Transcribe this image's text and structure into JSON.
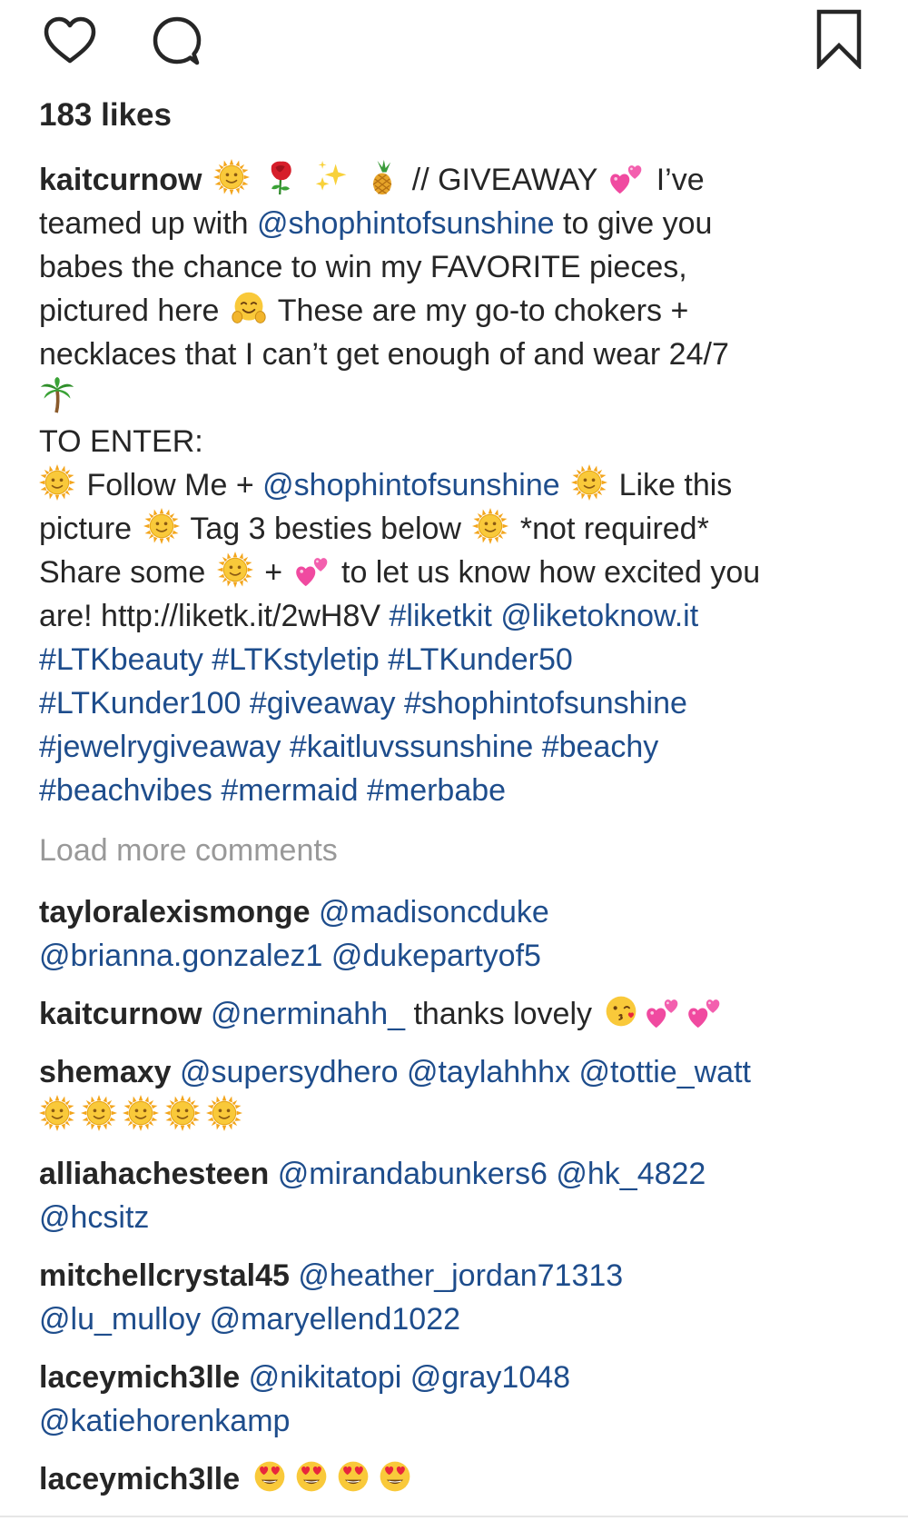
{
  "actions": {
    "like_icon": "heart-outline-icon",
    "comment_icon": "speech-bubble-icon",
    "save_icon": "bookmark-outline-icon"
  },
  "likes_text": "183 likes",
  "caption": {
    "username": "kaitcurnow",
    "l1_text_a": "// GIVEAWAY",
    "l1_text_b": "I’ve",
    "l2_text_a": "teamed up with",
    "l2_mention": "@shophintofsunshine",
    "l2_text_b": "to give you",
    "l3": "babes the chance to win my FAVORITE pieces,",
    "l4_text_a": "pictured here",
    "l4_text_b": "These are my go-to chokers +",
    "l5": "necklaces that I can’t get enough of and wear 24/7",
    "l7": "TO ENTER:",
    "l8_text_a": "Follow Me +",
    "l8_mention": "@shophintofsunshine",
    "l8_text_b": "Like this",
    "l9_text_a": "picture",
    "l9_text_b": "Tag 3 besties below",
    "l9_text_c": "*not required*",
    "l10_text_a": "Share some",
    "l10_text_b": "+",
    "l10_text_c": "to let us know how excited you",
    "l11_text_a": "are! http://liketk.it/2wH8V",
    "l11_tag_a": "#liketkit",
    "l11_mention": "@liketoknow.it",
    "l12": "#LTKbeauty #LTKstyletip #LTKunder50",
    "l13": "#LTKunder100 #giveaway #shophintofsunshine",
    "l14": "#jewelrygiveaway #kaitluvssunshine #beachy",
    "l15": "#beachvibes #mermaid #merbabe"
  },
  "load_more": "Load more comments",
  "comments": [
    {
      "user": "tayloralexismonge",
      "line1": "@madisoncduke",
      "line2": "@brianna.gonzalez1 @dukepartyof5"
    },
    {
      "user": "kaitcurnow",
      "mention": "@nerminahh_",
      "text": "thanks lovely"
    },
    {
      "user": "shemaxy",
      "line1": "@supersydhero @taylahhhx @tottie_watt"
    },
    {
      "user": "alliahachesteen",
      "line1": "@mirandabunkers6 @hk_4822",
      "line2": "@hcsitz"
    },
    {
      "user": "mitchellcrystal45",
      "line1": "@heather_jordan71313",
      "line2": "@lu_mulloy @maryellend1022"
    },
    {
      "user": "laceymich3lle",
      "line1": "@nikitatopi @gray1048",
      "line2": "@katiehorenkamp"
    },
    {
      "user": "laceymich3lle"
    }
  ],
  "colors": {
    "text": "#262626",
    "link": "#1e4d8c",
    "muted": "#999999",
    "sun": "#f7c325",
    "heart_pink": "#f04aa0"
  }
}
